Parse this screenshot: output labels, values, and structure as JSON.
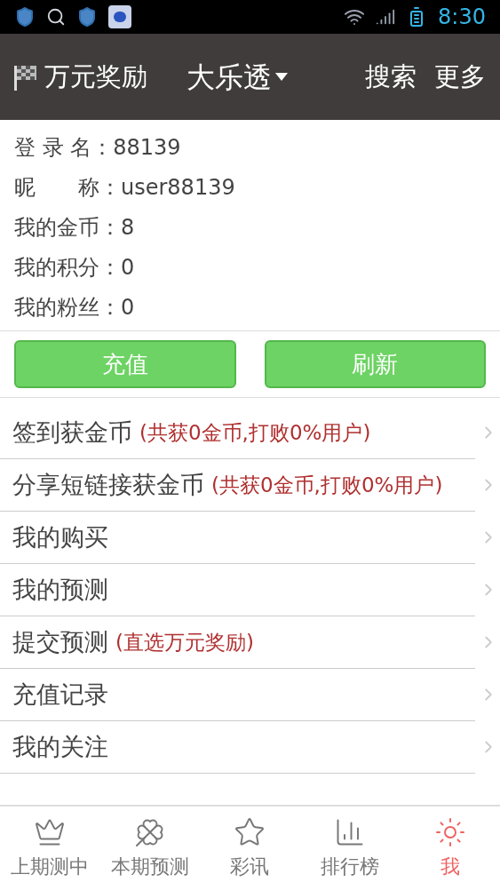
{
  "status_bar": {
    "time": "8:30"
  },
  "header": {
    "title": "万元奖励",
    "lottery": "大乐透",
    "actions": [
      "搜索",
      "更多"
    ]
  },
  "profile": [
    {
      "label": "登 录 名：",
      "value": "88139"
    },
    {
      "label": "昵　　称：",
      "value": "user88139"
    },
    {
      "label": "我的金币：",
      "value": "8"
    },
    {
      "label": "我的积分：",
      "value": "0"
    },
    {
      "label": "我的粉丝：",
      "value": "0"
    }
  ],
  "buttons": [
    "充值",
    "刷新"
  ],
  "menu": [
    {
      "label": "签到获金币",
      "note": "(共获0金币,打败0%用户)"
    },
    {
      "label": "分享短链接获金币",
      "note": "(共获0金币,打败0%用户)"
    },
    {
      "label": "我的购买"
    },
    {
      "label": "我的预测"
    },
    {
      "label": "提交预测",
      "note": "(直选万元奖励)"
    },
    {
      "label": "充值记录"
    },
    {
      "label": "我的关注"
    }
  ],
  "tab_bar": [
    {
      "label": "上期测中",
      "kind": "crown",
      "selected": false
    },
    {
      "label": "本期预测",
      "kind": "clover",
      "selected": false
    },
    {
      "label": "彩讯",
      "kind": "star",
      "selected": false
    },
    {
      "label": "排行榜",
      "kind": "chart",
      "selected": false
    },
    {
      "label": "我",
      "kind": "sun",
      "selected": true
    }
  ]
}
